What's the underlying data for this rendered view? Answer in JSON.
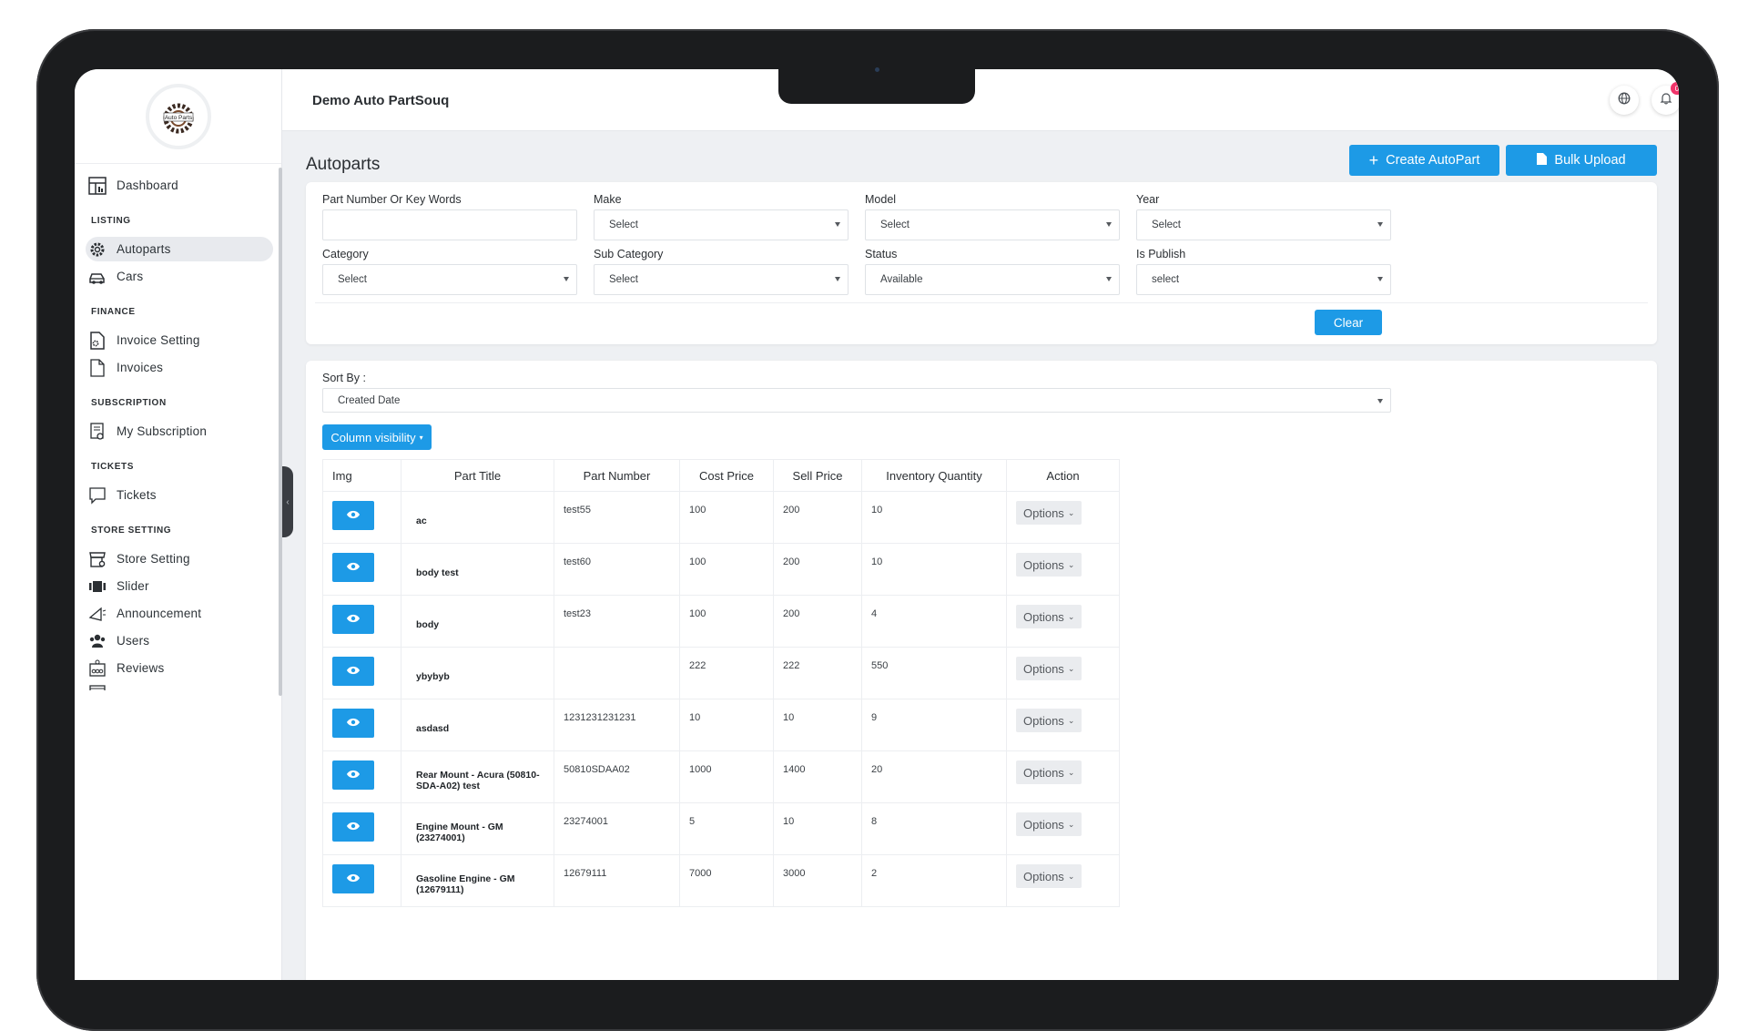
{
  "app": {
    "store_name": "Demo Auto PartSouq",
    "logo_text": "Auto Parts"
  },
  "topbar": {
    "notification_count": "0",
    "icons": [
      "globe-icon",
      "bell-icon",
      "user-avatar"
    ]
  },
  "sidebar": {
    "dashboard": "Dashboard",
    "sections": {
      "listing": "LISTING",
      "finance": "FINANCE",
      "subscription": "SUBSCRIPTION",
      "tickets": "TICKETS",
      "store_setting": "STORE SETTING"
    },
    "items": {
      "autoparts": "Autoparts",
      "cars": "Cars",
      "invoice_setting": "Invoice Setting",
      "invoices": "Invoices",
      "my_subscription": "My Subscription",
      "tickets": "Tickets",
      "store_setting": "Store Setting",
      "slider": "Slider",
      "announcement": "Announcement",
      "users": "Users",
      "reviews": "Reviews"
    }
  },
  "page": {
    "title": "Autoparts",
    "create_button": "Create AutoPart",
    "bulk_upload_button": "Bulk Upload"
  },
  "filters": {
    "part_number_label": "Part Number Or Key Words",
    "part_number_value": "",
    "make_label": "Make",
    "make_value": "Select",
    "model_label": "Model",
    "model_value": "Select",
    "year_label": "Year",
    "year_value": "Select",
    "category_label": "Category",
    "category_value": "Select",
    "sub_category_label": "Sub Category",
    "sub_category_value": "Select",
    "status_label": "Status",
    "status_value": "Available",
    "is_publish_label": "Is Publish",
    "is_publish_value": "select",
    "clear_button": "Clear"
  },
  "sort": {
    "label": "Sort By :",
    "value": "Created Date"
  },
  "column_visibility_button": "Column visibility",
  "table": {
    "headers": {
      "img": "Img",
      "title": "Part Title",
      "part_number": "Part Number",
      "cost": "Cost Price",
      "sell": "Sell Price",
      "qty": "Inventory Quantity",
      "action": "Action"
    },
    "options_label": "Options",
    "rows": [
      {
        "title": "ac",
        "part_number": "test55",
        "cost": "100",
        "sell": "200",
        "qty": "10"
      },
      {
        "title": "body test",
        "part_number": "test60",
        "cost": "100",
        "sell": "200",
        "qty": "10"
      },
      {
        "title": "body",
        "part_number": "test23",
        "cost": "100",
        "sell": "200",
        "qty": "4"
      },
      {
        "title": "ybybyb",
        "part_number": "",
        "cost": "222",
        "sell": "222",
        "qty": "550"
      },
      {
        "title": "asdasd",
        "part_number": "1231231231231",
        "cost": "10",
        "sell": "10",
        "qty": "9"
      },
      {
        "title": "Rear Mount - Acura (50810-SDA-A02) test",
        "part_number": "50810SDAA02",
        "cost": "1000",
        "sell": "1400",
        "qty": "20"
      },
      {
        "title": "Engine Mount - GM (23274001)",
        "part_number": "23274001",
        "cost": "5",
        "sell": "10",
        "qty": "8"
      },
      {
        "title": "Gasoline Engine - GM (12679111)",
        "part_number": "12679111",
        "cost": "7000",
        "sell": "3000",
        "qty": "2"
      }
    ]
  },
  "colors": {
    "accent": "#1d9ae6",
    "badge": "#f0346a",
    "frame": "#1b1c1e"
  }
}
